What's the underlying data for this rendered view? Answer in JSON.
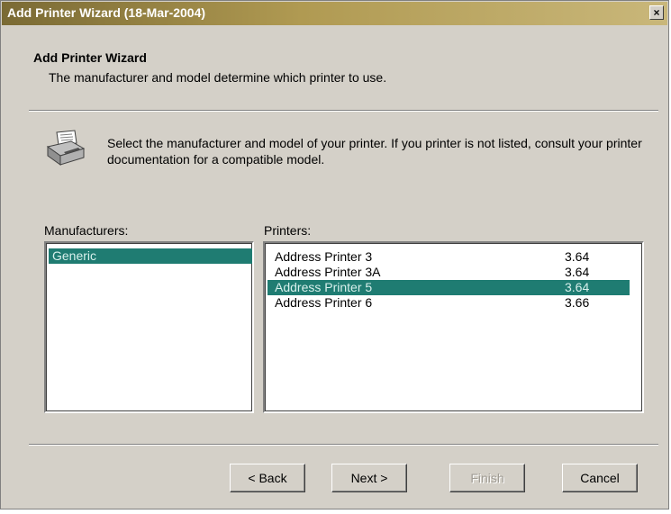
{
  "window": {
    "title": "Add Printer Wizard (18-Mar-2004)",
    "close_label": "×"
  },
  "header": {
    "title": "Add Printer Wizard",
    "subtitle": "The manufacturer and model determine which printer to use."
  },
  "instruction": "Select the manufacturer and model of your printer. If you printer is not listed, consult your printer documentation for a compatible model.",
  "manufacturers": {
    "label": "Manufacturers:",
    "items": [
      {
        "name": "Generic",
        "selected": true
      }
    ]
  },
  "printers": {
    "label": "Printers:",
    "items": [
      {
        "name": "Address Printer 3",
        "version": "3.64",
        "selected": false
      },
      {
        "name": "Address Printer 3A",
        "version": "3.64",
        "selected": false
      },
      {
        "name": "Address Printer 5",
        "version": "3.64",
        "selected": true
      },
      {
        "name": "Address Printer 6",
        "version": "3.66",
        "selected": false
      }
    ]
  },
  "buttons": {
    "back": "< Back",
    "next": "Next >",
    "finish": "Finish",
    "cancel": "Cancel"
  },
  "icons": {
    "printer": "printer-icon",
    "close": "close-icon"
  },
  "colors": {
    "selection": "#1f7c72",
    "dialog": "#d4d0c8"
  }
}
